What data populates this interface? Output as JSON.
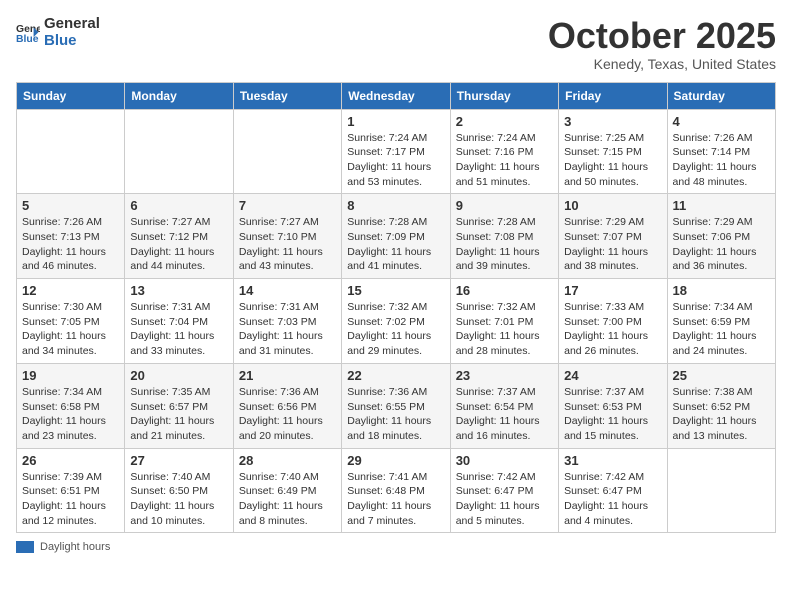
{
  "header": {
    "logo_general": "General",
    "logo_blue": "Blue",
    "title": "October 2025",
    "subtitle": "Kenedy, Texas, United States"
  },
  "days_of_week": [
    "Sunday",
    "Monday",
    "Tuesday",
    "Wednesday",
    "Thursday",
    "Friday",
    "Saturday"
  ],
  "weeks": [
    [
      {
        "day": "",
        "info": ""
      },
      {
        "day": "",
        "info": ""
      },
      {
        "day": "",
        "info": ""
      },
      {
        "day": "1",
        "info": "Sunrise: 7:24 AM\nSunset: 7:17 PM\nDaylight: 11 hours\nand 53 minutes."
      },
      {
        "day": "2",
        "info": "Sunrise: 7:24 AM\nSunset: 7:16 PM\nDaylight: 11 hours\nand 51 minutes."
      },
      {
        "day": "3",
        "info": "Sunrise: 7:25 AM\nSunset: 7:15 PM\nDaylight: 11 hours\nand 50 minutes."
      },
      {
        "day": "4",
        "info": "Sunrise: 7:26 AM\nSunset: 7:14 PM\nDaylight: 11 hours\nand 48 minutes."
      }
    ],
    [
      {
        "day": "5",
        "info": "Sunrise: 7:26 AM\nSunset: 7:13 PM\nDaylight: 11 hours\nand 46 minutes."
      },
      {
        "day": "6",
        "info": "Sunrise: 7:27 AM\nSunset: 7:12 PM\nDaylight: 11 hours\nand 44 minutes."
      },
      {
        "day": "7",
        "info": "Sunrise: 7:27 AM\nSunset: 7:10 PM\nDaylight: 11 hours\nand 43 minutes."
      },
      {
        "day": "8",
        "info": "Sunrise: 7:28 AM\nSunset: 7:09 PM\nDaylight: 11 hours\nand 41 minutes."
      },
      {
        "day": "9",
        "info": "Sunrise: 7:28 AM\nSunset: 7:08 PM\nDaylight: 11 hours\nand 39 minutes."
      },
      {
        "day": "10",
        "info": "Sunrise: 7:29 AM\nSunset: 7:07 PM\nDaylight: 11 hours\nand 38 minutes."
      },
      {
        "day": "11",
        "info": "Sunrise: 7:29 AM\nSunset: 7:06 PM\nDaylight: 11 hours\nand 36 minutes."
      }
    ],
    [
      {
        "day": "12",
        "info": "Sunrise: 7:30 AM\nSunset: 7:05 PM\nDaylight: 11 hours\nand 34 minutes."
      },
      {
        "day": "13",
        "info": "Sunrise: 7:31 AM\nSunset: 7:04 PM\nDaylight: 11 hours\nand 33 minutes."
      },
      {
        "day": "14",
        "info": "Sunrise: 7:31 AM\nSunset: 7:03 PM\nDaylight: 11 hours\nand 31 minutes."
      },
      {
        "day": "15",
        "info": "Sunrise: 7:32 AM\nSunset: 7:02 PM\nDaylight: 11 hours\nand 29 minutes."
      },
      {
        "day": "16",
        "info": "Sunrise: 7:32 AM\nSunset: 7:01 PM\nDaylight: 11 hours\nand 28 minutes."
      },
      {
        "day": "17",
        "info": "Sunrise: 7:33 AM\nSunset: 7:00 PM\nDaylight: 11 hours\nand 26 minutes."
      },
      {
        "day": "18",
        "info": "Sunrise: 7:34 AM\nSunset: 6:59 PM\nDaylight: 11 hours\nand 24 minutes."
      }
    ],
    [
      {
        "day": "19",
        "info": "Sunrise: 7:34 AM\nSunset: 6:58 PM\nDaylight: 11 hours\nand 23 minutes."
      },
      {
        "day": "20",
        "info": "Sunrise: 7:35 AM\nSunset: 6:57 PM\nDaylight: 11 hours\nand 21 minutes."
      },
      {
        "day": "21",
        "info": "Sunrise: 7:36 AM\nSunset: 6:56 PM\nDaylight: 11 hours\nand 20 minutes."
      },
      {
        "day": "22",
        "info": "Sunrise: 7:36 AM\nSunset: 6:55 PM\nDaylight: 11 hours\nand 18 minutes."
      },
      {
        "day": "23",
        "info": "Sunrise: 7:37 AM\nSunset: 6:54 PM\nDaylight: 11 hours\nand 16 minutes."
      },
      {
        "day": "24",
        "info": "Sunrise: 7:37 AM\nSunset: 6:53 PM\nDaylight: 11 hours\nand 15 minutes."
      },
      {
        "day": "25",
        "info": "Sunrise: 7:38 AM\nSunset: 6:52 PM\nDaylight: 11 hours\nand 13 minutes."
      }
    ],
    [
      {
        "day": "26",
        "info": "Sunrise: 7:39 AM\nSunset: 6:51 PM\nDaylight: 11 hours\nand 12 minutes."
      },
      {
        "day": "27",
        "info": "Sunrise: 7:40 AM\nSunset: 6:50 PM\nDaylight: 11 hours\nand 10 minutes."
      },
      {
        "day": "28",
        "info": "Sunrise: 7:40 AM\nSunset: 6:49 PM\nDaylight: 11 hours\nand 8 minutes."
      },
      {
        "day": "29",
        "info": "Sunrise: 7:41 AM\nSunset: 6:48 PM\nDaylight: 11 hours\nand 7 minutes."
      },
      {
        "day": "30",
        "info": "Sunrise: 7:42 AM\nSunset: 6:47 PM\nDaylight: 11 hours\nand 5 minutes."
      },
      {
        "day": "31",
        "info": "Sunrise: 7:42 AM\nSunset: 6:47 PM\nDaylight: 11 hours\nand 4 minutes."
      },
      {
        "day": "",
        "info": ""
      }
    ]
  ],
  "legend": {
    "daylight_hours": "Daylight hours"
  }
}
